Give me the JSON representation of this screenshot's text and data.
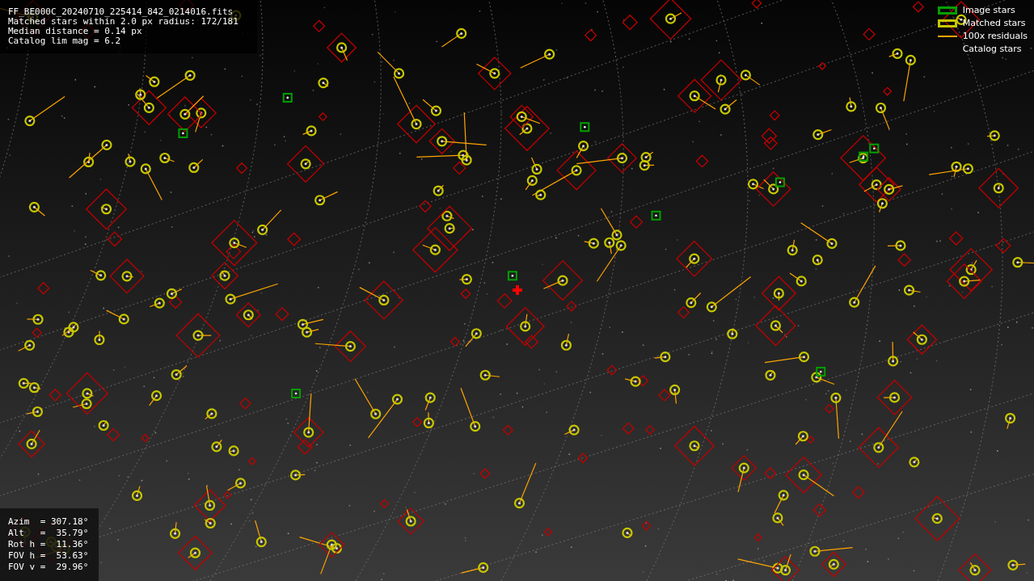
{
  "info": {
    "lines": [
      "FF_BE000C_20240710_225414_842_0214016.fits",
      "Matched stars within 2.0 px radius: 172/181",
      "Median distance = 0.14 px",
      "Catalog lim mag = 6.2"
    ]
  },
  "legend": [
    {
      "kind": "box",
      "color": "#00a000",
      "label": "Image stars"
    },
    {
      "kind": "box",
      "color": "#c8c800",
      "label": "Matched stars"
    },
    {
      "kind": "line",
      "color": "#ffa500",
      "label": "100x residuals"
    },
    {
      "kind": "none",
      "label": "Catalog stars"
    }
  ],
  "pointing": {
    "lines": [
      "Azim  = 307.18°",
      "Alt   =  35.79°",
      "Rot h =  11.36°",
      "FOV h =  53.63°",
      "FOV v =  29.96°"
    ]
  }
}
